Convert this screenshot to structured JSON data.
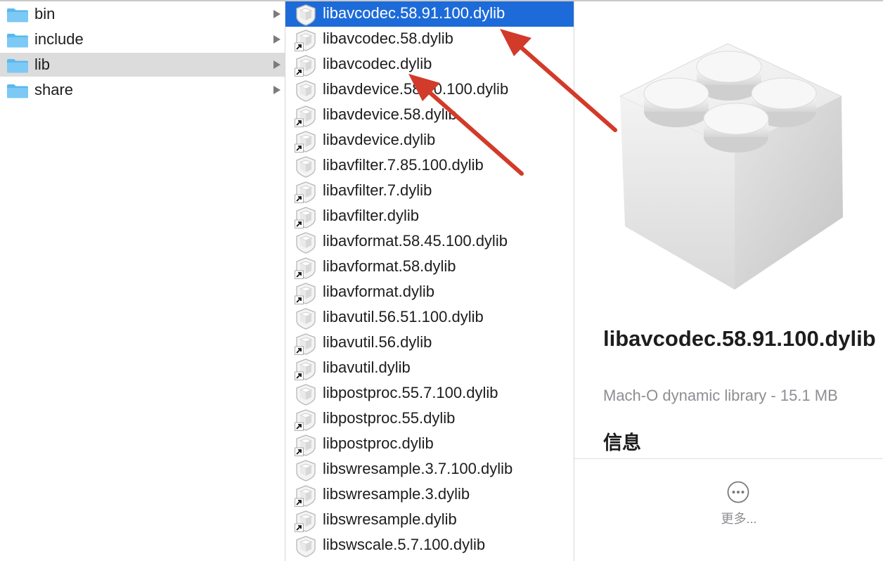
{
  "column1": {
    "items": [
      {
        "label": "bin",
        "icon": "folder-icon",
        "selected": false
      },
      {
        "label": "include",
        "icon": "folder-icon",
        "selected": false
      },
      {
        "label": "lib",
        "icon": "folder-icon",
        "selected": true
      },
      {
        "label": "share",
        "icon": "folder-icon",
        "selected": false
      }
    ]
  },
  "column2": {
    "items": [
      {
        "label": "libavcodec.58.91.100.dylib",
        "alias": false,
        "selected": true
      },
      {
        "label": "libavcodec.58.dylib",
        "alias": true,
        "selected": false
      },
      {
        "label": "libavcodec.dylib",
        "alias": true,
        "selected": false
      },
      {
        "label": "libavdevice.58.10.100.dylib",
        "alias": false,
        "selected": false
      },
      {
        "label": "libavdevice.58.dylib",
        "alias": true,
        "selected": false
      },
      {
        "label": "libavdevice.dylib",
        "alias": true,
        "selected": false
      },
      {
        "label": "libavfilter.7.85.100.dylib",
        "alias": false,
        "selected": false
      },
      {
        "label": "libavfilter.7.dylib",
        "alias": true,
        "selected": false
      },
      {
        "label": "libavfilter.dylib",
        "alias": true,
        "selected": false
      },
      {
        "label": "libavformat.58.45.100.dylib",
        "alias": false,
        "selected": false
      },
      {
        "label": "libavformat.58.dylib",
        "alias": true,
        "selected": false
      },
      {
        "label": "libavformat.dylib",
        "alias": true,
        "selected": false
      },
      {
        "label": "libavutil.56.51.100.dylib",
        "alias": false,
        "selected": false
      },
      {
        "label": "libavutil.56.dylib",
        "alias": true,
        "selected": false
      },
      {
        "label": "libavutil.dylib",
        "alias": true,
        "selected": false
      },
      {
        "label": "libpostproc.55.7.100.dylib",
        "alias": false,
        "selected": false
      },
      {
        "label": "libpostproc.55.dylib",
        "alias": true,
        "selected": false
      },
      {
        "label": "libpostproc.dylib",
        "alias": true,
        "selected": false
      },
      {
        "label": "libswresample.3.7.100.dylib",
        "alias": false,
        "selected": false
      },
      {
        "label": "libswresample.3.dylib",
        "alias": true,
        "selected": false
      },
      {
        "label": "libswresample.dylib",
        "alias": true,
        "selected": false
      },
      {
        "label": "libswscale.5.7.100.dylib",
        "alias": false,
        "selected": false
      }
    ]
  },
  "preview": {
    "icon": "library-bundle-icon",
    "name": "libavcodec.58.91.100.dylib",
    "kind": "Mach-O dynamic library - 15.1 MB",
    "info_heading": "信息",
    "more_label": "更多..."
  },
  "colors": {
    "selection": "#1d6bd9",
    "sidebar_selection": "#dcdcdc",
    "arrow": "#d23a2a",
    "folder": "#5ab8f0"
  }
}
